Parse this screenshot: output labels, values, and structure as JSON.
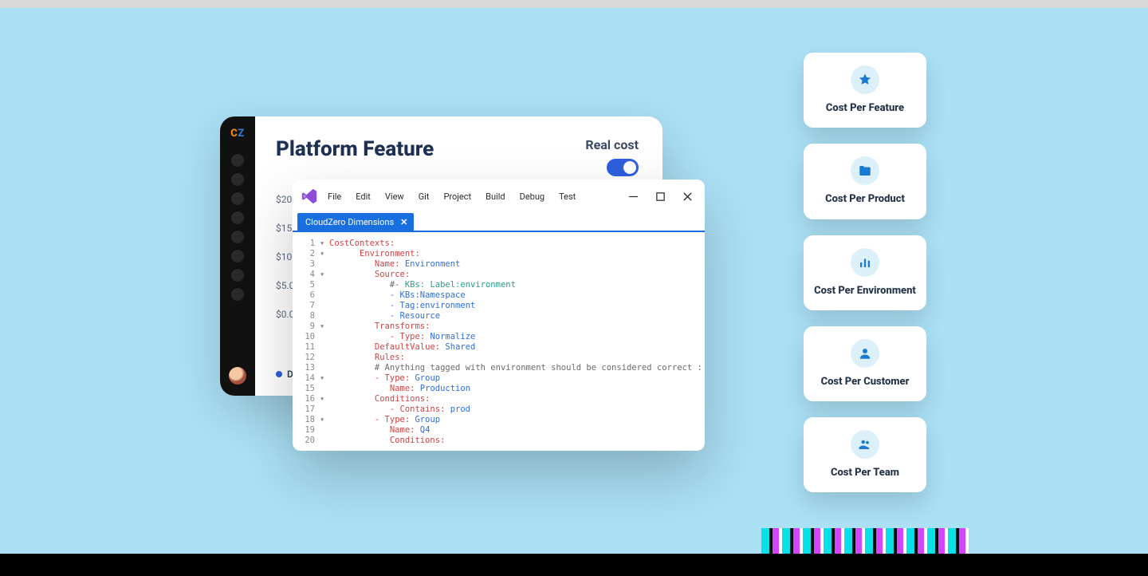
{
  "dashboard": {
    "title": "Platform Feature",
    "real_cost_label": "Real cost",
    "toggle_on": true,
    "axis": [
      "$20.",
      "$15.",
      "$10.",
      "$5.0",
      "$0.0"
    ],
    "legend": {
      "dot_color": "#2f5fe0",
      "label": "D."
    }
  },
  "code_window": {
    "menu": [
      "File",
      "Edit",
      "View",
      "Git",
      "Project",
      "Build",
      "Debug",
      "Test"
    ],
    "tab_name": "CloudZero Dimensions",
    "lines": [
      {
        "n": 1,
        "fold": "▾",
        "indent": 0,
        "tokens": [
          {
            "t": "CostContexts:",
            "c": "k-red"
          }
        ]
      },
      {
        "n": 2,
        "fold": "▾",
        "indent": 2,
        "tokens": [
          {
            "t": "Environment:",
            "c": "k-red"
          }
        ]
      },
      {
        "n": 3,
        "fold": "",
        "indent": 3,
        "tokens": [
          {
            "t": "Name: ",
            "c": "k-red"
          },
          {
            "t": "Environment",
            "c": "k-blue"
          }
        ]
      },
      {
        "n": 4,
        "fold": "▾",
        "indent": 3,
        "tokens": [
          {
            "t": "Source:",
            "c": "k-red"
          }
        ]
      },
      {
        "n": 5,
        "fold": "",
        "indent": 4,
        "tokens": [
          {
            "t": "#- ",
            "c": "k-gray"
          },
          {
            "t": "KBs: ",
            "c": "k-teal"
          },
          {
            "t": "Label:environment",
            "c": "k-teal"
          }
        ]
      },
      {
        "n": 6,
        "fold": "",
        "indent": 4,
        "tokens": [
          {
            "t": "- ",
            "c": "k-blue"
          },
          {
            "t": "KBs:Namespace",
            "c": "k-blue"
          }
        ]
      },
      {
        "n": 7,
        "fold": "",
        "indent": 4,
        "tokens": [
          {
            "t": "- ",
            "c": "k-blue"
          },
          {
            "t": "Tag:environment",
            "c": "k-blue"
          }
        ]
      },
      {
        "n": 8,
        "fold": "",
        "indent": 4,
        "tokens": [
          {
            "t": "- ",
            "c": "k-blue"
          },
          {
            "t": "Resource",
            "c": "k-blue"
          }
        ]
      },
      {
        "n": 9,
        "fold": "▾",
        "indent": 3,
        "tokens": [
          {
            "t": "Transforms:",
            "c": "k-red"
          }
        ]
      },
      {
        "n": 10,
        "fold": "",
        "indent": 4,
        "tokens": [
          {
            "t": "- Type: ",
            "c": "k-red"
          },
          {
            "t": "Normalize",
            "c": "k-blue"
          }
        ]
      },
      {
        "n": 11,
        "fold": "",
        "indent": 3,
        "tokens": [
          {
            "t": "DefaultValue: ",
            "c": "k-red"
          },
          {
            "t": "Shared",
            "c": "k-blue"
          }
        ]
      },
      {
        "n": 12,
        "fold": "",
        "indent": 3,
        "tokens": [
          {
            "t": "Rules:",
            "c": "k-red"
          }
        ]
      },
      {
        "n": 13,
        "fold": "",
        "indent": 3,
        "tokens": [
          {
            "t": "# Anything tagged with environment should be considered correct :",
            "c": "k-gray"
          }
        ]
      },
      {
        "n": 14,
        "fold": "▾",
        "indent": 3,
        "tokens": [
          {
            "t": "- Type: ",
            "c": "k-red"
          },
          {
            "t": "Group",
            "c": "k-blue"
          }
        ]
      },
      {
        "n": 15,
        "fold": "",
        "indent": 4,
        "tokens": [
          {
            "t": "Name: ",
            "c": "k-red"
          },
          {
            "t": "Production",
            "c": "k-blue"
          }
        ]
      },
      {
        "n": 16,
        "fold": "▾",
        "indent": 3,
        "tokens": [
          {
            "t": "Conditions:",
            "c": "k-red"
          }
        ]
      },
      {
        "n": 17,
        "fold": "",
        "indent": 4,
        "tokens": [
          {
            "t": "- Contains: ",
            "c": "k-red"
          },
          {
            "t": "prod",
            "c": "k-blue"
          }
        ]
      },
      {
        "n": 18,
        "fold": "▾",
        "indent": 3,
        "tokens": [
          {
            "t": "- Type: ",
            "c": "k-red"
          },
          {
            "t": "Group",
            "c": "k-blue"
          }
        ]
      },
      {
        "n": 19,
        "fold": "",
        "indent": 4,
        "tokens": [
          {
            "t": "Name: ",
            "c": "k-red"
          },
          {
            "t": "Q4",
            "c": "k-blue"
          }
        ]
      },
      {
        "n": 20,
        "fold": "",
        "indent": 4,
        "tokens": [
          {
            "t": "Conditions:",
            "c": "k-red"
          }
        ]
      }
    ]
  },
  "metrics": [
    {
      "icon": "star",
      "label": "Cost Per Feature"
    },
    {
      "icon": "folder",
      "label": "Cost Per Product"
    },
    {
      "icon": "chart",
      "label": "Cost Per Environment"
    },
    {
      "icon": "person",
      "label": "Cost Per Customer"
    },
    {
      "icon": "team",
      "label": "Cost Per Team"
    }
  ]
}
